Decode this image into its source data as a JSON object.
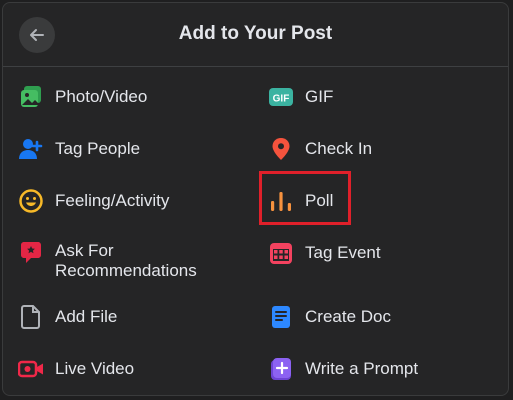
{
  "header": {
    "title": "Add to Your Post"
  },
  "items": {
    "photo_video": "Photo/Video",
    "gif": "GIF",
    "gif_badge": "GIF",
    "tag_people": "Tag People",
    "check_in": "Check In",
    "feeling_activity": "Feeling/Activity",
    "poll": "Poll",
    "ask_recommendations": "Ask For\nRecommendations",
    "tag_event": "Tag Event",
    "add_file": "Add File",
    "create_doc": "Create Doc",
    "live_video": "Live Video",
    "write_prompt": "Write a Prompt"
  },
  "colors": {
    "photo": "#45bd62",
    "gif": "#3bb3a1",
    "tag": "#1877f2",
    "checkin": "#f5533d",
    "feeling": "#f7b928",
    "poll": "#f7923e",
    "ask": "#e42645",
    "event": "#f3425f",
    "file": "#b0b3b8",
    "doc": "#2d88ff",
    "live": "#f02849",
    "prompt": "#8c62f2",
    "highlight": "#e0202a"
  }
}
